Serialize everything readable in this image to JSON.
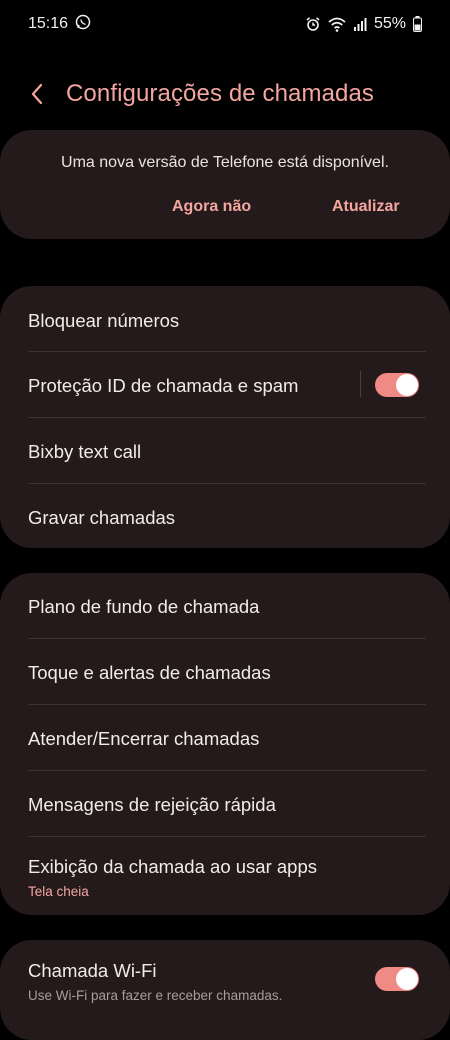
{
  "status_bar": {
    "time": "15:16",
    "battery": "55%",
    "icons": [
      "whatsapp-icon",
      "alarm-icon",
      "wifi-icon",
      "signal-icon",
      "battery-icon"
    ]
  },
  "header": {
    "title": "Configurações de chamadas"
  },
  "update_banner": {
    "message": "Uma nova versão de Telefone está disponível.",
    "later_label": "Agora não",
    "update_label": "Atualizar"
  },
  "group1": {
    "items": [
      {
        "label": "Bloquear números"
      },
      {
        "label": "Proteção ID de chamada e spam",
        "toggle_on": true
      },
      {
        "label": "Bixby text call"
      },
      {
        "label": "Gravar chamadas"
      }
    ]
  },
  "group2": {
    "items": [
      {
        "label": "Plano de fundo de chamada"
      },
      {
        "label": "Toque e alertas de chamadas"
      },
      {
        "label": "Atender/Encerrar chamadas"
      },
      {
        "label": "Mensagens de rejeição rápida"
      },
      {
        "label": "Exibição da chamada ao usar apps",
        "sub": "Tela cheia"
      }
    ]
  },
  "group3": {
    "items": [
      {
        "label": "Chamada Wi-Fi",
        "sub": "Use Wi-Fi para fazer e receber chamadas.",
        "toggle_on": true
      }
    ]
  },
  "colors": {
    "accent": "#f3a6a0",
    "toggle_track": "#f08a85",
    "card_bg": "#241a1b",
    "background": "#000000"
  }
}
